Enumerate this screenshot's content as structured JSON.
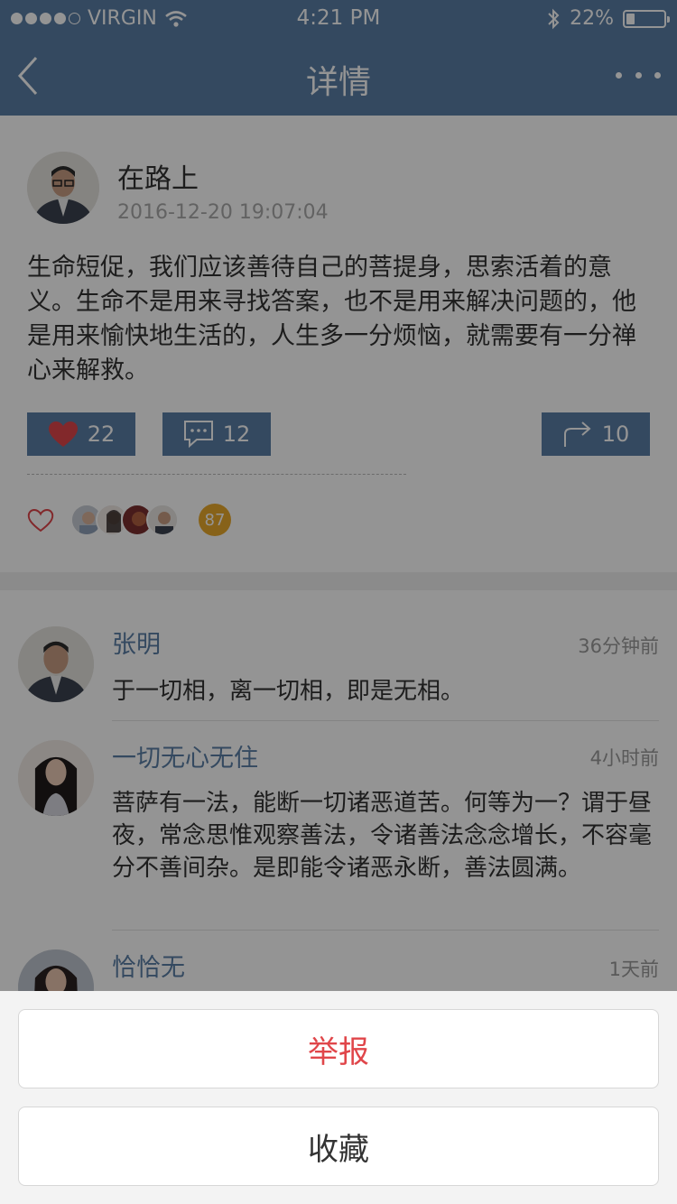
{
  "status_bar": {
    "carrier": "VIRGIN",
    "time": "4:21 PM",
    "battery": "22%",
    "battery_level": 0.22
  },
  "header": {
    "title": "详情",
    "back_icon": "chevron-left-icon",
    "more_icon": "more-dots-icon"
  },
  "post": {
    "author": "在路上",
    "timestamp": "2016-12-20 19:07:04",
    "content": "生命短促，我们应该善待自己的菩提身，思索活着的意义。生命不是用来寻找答案，也不是用来解决问题的，他是用来愉快地生活的，人生多一分烦恼，就需要有一分禅心来解救。",
    "like_count": "22",
    "comment_count": "12",
    "share_count": "10",
    "liker_count": "87"
  },
  "comments": [
    {
      "name": "张明",
      "time": "36分钟前",
      "text": "于一切相，离一切相，即是无相。"
    },
    {
      "name": "一切无心无住",
      "time": "4小时前",
      "text": "菩萨有一法，能断一切诸恶道苦。何等为一？谓于昼夜，常念思惟观察善法，令诸善法念念增长，不容毫分不善间杂。是即能令诸恶永断，善法圆满。"
    },
    {
      "name": "恰恰无",
      "time": "1天前",
      "text": ""
    }
  ],
  "action_sheet": {
    "report_label": "举报",
    "collect_label": "收藏"
  },
  "colors": {
    "nav": "#5b7fa6",
    "accent_red": "#e0464a",
    "badge": "#e9a92b"
  }
}
